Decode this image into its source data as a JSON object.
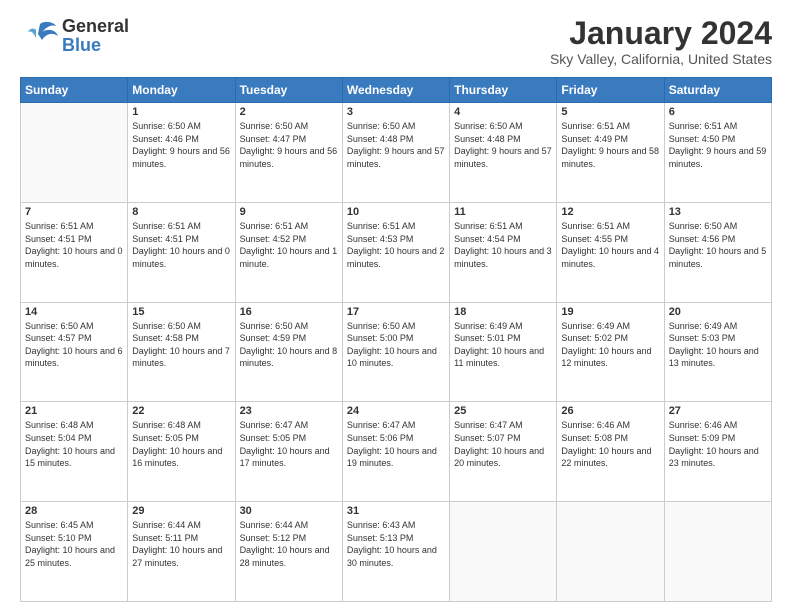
{
  "header": {
    "logo_general": "General",
    "logo_blue": "Blue",
    "title": "January 2024",
    "subtitle": "Sky Valley, California, United States"
  },
  "weekdays": [
    "Sunday",
    "Monday",
    "Tuesday",
    "Wednesday",
    "Thursday",
    "Friday",
    "Saturday"
  ],
  "weeks": [
    [
      {
        "day": "",
        "sunrise": "",
        "sunset": "",
        "daylight": ""
      },
      {
        "day": "1",
        "sunrise": "Sunrise: 6:50 AM",
        "sunset": "Sunset: 4:46 PM",
        "daylight": "Daylight: 9 hours and 56 minutes."
      },
      {
        "day": "2",
        "sunrise": "Sunrise: 6:50 AM",
        "sunset": "Sunset: 4:47 PM",
        "daylight": "Daylight: 9 hours and 56 minutes."
      },
      {
        "day": "3",
        "sunrise": "Sunrise: 6:50 AM",
        "sunset": "Sunset: 4:48 PM",
        "daylight": "Daylight: 9 hours and 57 minutes."
      },
      {
        "day": "4",
        "sunrise": "Sunrise: 6:50 AM",
        "sunset": "Sunset: 4:48 PM",
        "daylight": "Daylight: 9 hours and 57 minutes."
      },
      {
        "day": "5",
        "sunrise": "Sunrise: 6:51 AM",
        "sunset": "Sunset: 4:49 PM",
        "daylight": "Daylight: 9 hours and 58 minutes."
      },
      {
        "day": "6",
        "sunrise": "Sunrise: 6:51 AM",
        "sunset": "Sunset: 4:50 PM",
        "daylight": "Daylight: 9 hours and 59 minutes."
      }
    ],
    [
      {
        "day": "7",
        "sunrise": "Sunrise: 6:51 AM",
        "sunset": "Sunset: 4:51 PM",
        "daylight": "Daylight: 10 hours and 0 minutes."
      },
      {
        "day": "8",
        "sunrise": "Sunrise: 6:51 AM",
        "sunset": "Sunset: 4:51 PM",
        "daylight": "Daylight: 10 hours and 0 minutes."
      },
      {
        "day": "9",
        "sunrise": "Sunrise: 6:51 AM",
        "sunset": "Sunset: 4:52 PM",
        "daylight": "Daylight: 10 hours and 1 minute."
      },
      {
        "day": "10",
        "sunrise": "Sunrise: 6:51 AM",
        "sunset": "Sunset: 4:53 PM",
        "daylight": "Daylight: 10 hours and 2 minutes."
      },
      {
        "day": "11",
        "sunrise": "Sunrise: 6:51 AM",
        "sunset": "Sunset: 4:54 PM",
        "daylight": "Daylight: 10 hours and 3 minutes."
      },
      {
        "day": "12",
        "sunrise": "Sunrise: 6:51 AM",
        "sunset": "Sunset: 4:55 PM",
        "daylight": "Daylight: 10 hours and 4 minutes."
      },
      {
        "day": "13",
        "sunrise": "Sunrise: 6:50 AM",
        "sunset": "Sunset: 4:56 PM",
        "daylight": "Daylight: 10 hours and 5 minutes."
      }
    ],
    [
      {
        "day": "14",
        "sunrise": "Sunrise: 6:50 AM",
        "sunset": "Sunset: 4:57 PM",
        "daylight": "Daylight: 10 hours and 6 minutes."
      },
      {
        "day": "15",
        "sunrise": "Sunrise: 6:50 AM",
        "sunset": "Sunset: 4:58 PM",
        "daylight": "Daylight: 10 hours and 7 minutes."
      },
      {
        "day": "16",
        "sunrise": "Sunrise: 6:50 AM",
        "sunset": "Sunset: 4:59 PM",
        "daylight": "Daylight: 10 hours and 8 minutes."
      },
      {
        "day": "17",
        "sunrise": "Sunrise: 6:50 AM",
        "sunset": "Sunset: 5:00 PM",
        "daylight": "Daylight: 10 hours and 10 minutes."
      },
      {
        "day": "18",
        "sunrise": "Sunrise: 6:49 AM",
        "sunset": "Sunset: 5:01 PM",
        "daylight": "Daylight: 10 hours and 11 minutes."
      },
      {
        "day": "19",
        "sunrise": "Sunrise: 6:49 AM",
        "sunset": "Sunset: 5:02 PM",
        "daylight": "Daylight: 10 hours and 12 minutes."
      },
      {
        "day": "20",
        "sunrise": "Sunrise: 6:49 AM",
        "sunset": "Sunset: 5:03 PM",
        "daylight": "Daylight: 10 hours and 13 minutes."
      }
    ],
    [
      {
        "day": "21",
        "sunrise": "Sunrise: 6:48 AM",
        "sunset": "Sunset: 5:04 PM",
        "daylight": "Daylight: 10 hours and 15 minutes."
      },
      {
        "day": "22",
        "sunrise": "Sunrise: 6:48 AM",
        "sunset": "Sunset: 5:05 PM",
        "daylight": "Daylight: 10 hours and 16 minutes."
      },
      {
        "day": "23",
        "sunrise": "Sunrise: 6:47 AM",
        "sunset": "Sunset: 5:05 PM",
        "daylight": "Daylight: 10 hours and 17 minutes."
      },
      {
        "day": "24",
        "sunrise": "Sunrise: 6:47 AM",
        "sunset": "Sunset: 5:06 PM",
        "daylight": "Daylight: 10 hours and 19 minutes."
      },
      {
        "day": "25",
        "sunrise": "Sunrise: 6:47 AM",
        "sunset": "Sunset: 5:07 PM",
        "daylight": "Daylight: 10 hours and 20 minutes."
      },
      {
        "day": "26",
        "sunrise": "Sunrise: 6:46 AM",
        "sunset": "Sunset: 5:08 PM",
        "daylight": "Daylight: 10 hours and 22 minutes."
      },
      {
        "day": "27",
        "sunrise": "Sunrise: 6:46 AM",
        "sunset": "Sunset: 5:09 PM",
        "daylight": "Daylight: 10 hours and 23 minutes."
      }
    ],
    [
      {
        "day": "28",
        "sunrise": "Sunrise: 6:45 AM",
        "sunset": "Sunset: 5:10 PM",
        "daylight": "Daylight: 10 hours and 25 minutes."
      },
      {
        "day": "29",
        "sunrise": "Sunrise: 6:44 AM",
        "sunset": "Sunset: 5:11 PM",
        "daylight": "Daylight: 10 hours and 27 minutes."
      },
      {
        "day": "30",
        "sunrise": "Sunrise: 6:44 AM",
        "sunset": "Sunset: 5:12 PM",
        "daylight": "Daylight: 10 hours and 28 minutes."
      },
      {
        "day": "31",
        "sunrise": "Sunrise: 6:43 AM",
        "sunset": "Sunset: 5:13 PM",
        "daylight": "Daylight: 10 hours and 30 minutes."
      },
      {
        "day": "",
        "sunrise": "",
        "sunset": "",
        "daylight": ""
      },
      {
        "day": "",
        "sunrise": "",
        "sunset": "",
        "daylight": ""
      },
      {
        "day": "",
        "sunrise": "",
        "sunset": "",
        "daylight": ""
      }
    ]
  ]
}
